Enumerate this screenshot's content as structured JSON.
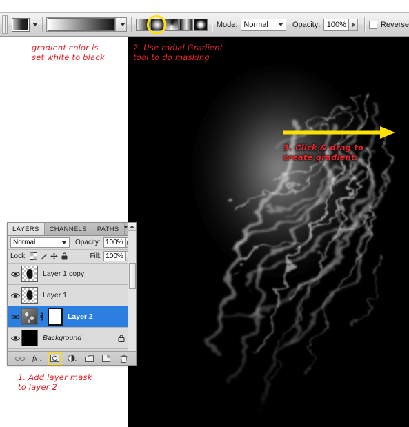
{
  "options_bar": {
    "tool_preset_name": "gradient-tool-preset",
    "gradient_preview_name": "white-to-black-gradient",
    "gradient_types": [
      {
        "name": "linear-gradient",
        "label": "Linear Gradient",
        "active": false
      },
      {
        "name": "radial-gradient",
        "label": "Radial Gradient",
        "active": true
      },
      {
        "name": "angle-gradient",
        "label": "Angle Gradient",
        "active": false
      },
      {
        "name": "reflected-gradient",
        "label": "Reflected Gradient",
        "active": false
      },
      {
        "name": "diamond-gradient",
        "label": "Diamond Gradient",
        "active": false
      }
    ],
    "mode_label": "Mode:",
    "mode_value": "Normal",
    "opacity_label": "Opacity:",
    "opacity_value": "100%",
    "reverse_label": "Reverse",
    "reverse_checked": false
  },
  "annotations": [
    {
      "id": "gradient-color-note",
      "text": "gradient color is\nset white to black"
    },
    {
      "id": "radial-gradient-note",
      "text": "2. Use radial Gradient\ntool to do masking"
    },
    {
      "id": "click-drag-note",
      "text": "3. Click & drag to\ncreate gradient."
    },
    {
      "id": "add-layer-mask-note",
      "text": "1. Add layer mask\nto layer 2"
    }
  ],
  "canvas": {
    "name": "smoke-image-canvas",
    "background_color": "#000000",
    "arrow_color": "#ffe000"
  },
  "layers_panel": {
    "tabs": [
      {
        "label": "LAYERS",
        "active": true
      },
      {
        "label": "CHANNELS",
        "active": false
      },
      {
        "label": "PATHS",
        "active": false
      }
    ],
    "blend_mode": "Normal",
    "opacity_label": "Opacity:",
    "opacity_value": "100%",
    "lock_label": "Lock:",
    "fill_label": "Fill:",
    "fill_value": "100%",
    "layers": [
      {
        "name": "Layer 1 copy",
        "visible": true,
        "selected": false,
        "type": "smoke",
        "has_mask": false,
        "locked": false
      },
      {
        "name": "Layer 1",
        "visible": true,
        "selected": false,
        "type": "smoke",
        "has_mask": false,
        "locked": false
      },
      {
        "name": "Layer 2",
        "visible": true,
        "selected": true,
        "type": "photo",
        "has_mask": true,
        "locked": false
      },
      {
        "name": "Background",
        "visible": true,
        "selected": false,
        "type": "black",
        "has_mask": false,
        "locked": true
      }
    ],
    "buttons": [
      {
        "name": "link-layers-button",
        "highlighted": false
      },
      {
        "name": "layer-style-fx-button",
        "highlighted": false
      },
      {
        "name": "add-layer-mask-button",
        "highlighted": true
      },
      {
        "name": "new-adjustment-layer-button",
        "highlighted": false
      },
      {
        "name": "new-group-button",
        "highlighted": false
      },
      {
        "name": "new-layer-button",
        "highlighted": false
      },
      {
        "name": "delete-layer-button",
        "highlighted": false
      }
    ]
  },
  "colors": {
    "accent_highlight": "#ffe000",
    "annotation_red": "#e0232a",
    "selection_blue": "#2a7fe0",
    "panel_gray": "#d6d6d6"
  }
}
